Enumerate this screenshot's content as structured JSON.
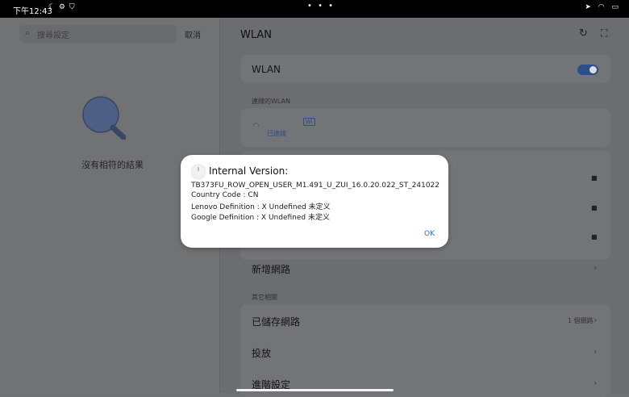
{
  "status_bar": {
    "time": "下午12:43",
    "dots": "• • •"
  },
  "settings_search": {
    "placeholder": "搜尋設定",
    "cancel": "取消",
    "no_results": "沒有相符的結果"
  },
  "wlan": {
    "title": "WLAN",
    "main_toggle_label": "WLAN",
    "toggle_on": true,
    "connected_section": "連線的WLAN",
    "connected_status": "已連線",
    "badge": "Wi",
    "add_network": "新增網路",
    "other_section": "其它相關",
    "saved_networks": "已儲存網路",
    "saved_count": "1 個網路",
    "cast": "投放",
    "advanced": "進階設定"
  },
  "dialog": {
    "title": "Internal Version:",
    "lines": [
      "TB373FU_ROW_OPEN_USER_M1.491_U_ZUI_16.0.20.022_ST_241022",
      "Country Code : CN",
      "Lenovo Definition : X Undefined 未定义",
      "Google Definition : X Undefined 未定义"
    ],
    "ok": "OK"
  },
  "colors": {
    "accent": "#1a73e8",
    "overlay": "#6f7174",
    "toggle": "#2c4f8a"
  },
  "icons": [
    "search-icon",
    "refresh-icon",
    "scan-icon",
    "lock-icon",
    "chevron-right-icon",
    "wifi-icon",
    "info-icon"
  ]
}
